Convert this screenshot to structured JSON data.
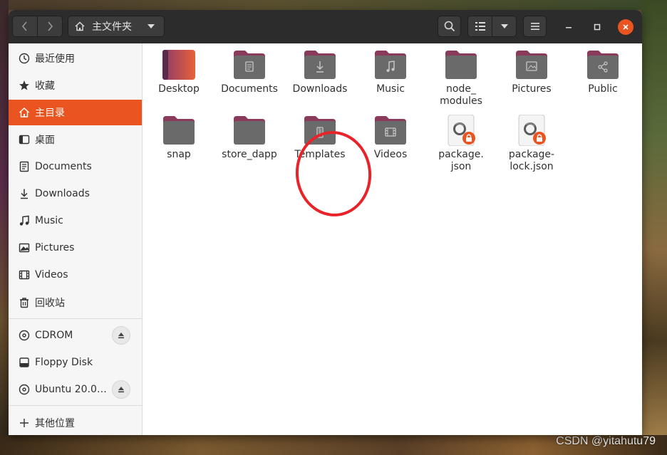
{
  "window": {
    "path_label": "主文件夹"
  },
  "sidebar": {
    "items": [
      {
        "label": "最近使用",
        "icon": "recent-icon"
      },
      {
        "label": "收藏",
        "icon": "star-icon"
      },
      {
        "label": "主目录",
        "icon": "home-icon",
        "active": true
      },
      {
        "label": "桌面",
        "icon": "desktop-icon"
      },
      {
        "label": "Documents",
        "icon": "document-icon"
      },
      {
        "label": "Downloads",
        "icon": "download-icon"
      },
      {
        "label": "Music",
        "icon": "music-icon"
      },
      {
        "label": "Pictures",
        "icon": "picture-icon"
      },
      {
        "label": "Videos",
        "icon": "video-icon"
      },
      {
        "label": "回收站",
        "icon": "trash-icon"
      }
    ],
    "devices": [
      {
        "label": "CDROM",
        "icon": "disc-icon",
        "eject": true
      },
      {
        "label": "Floppy Disk",
        "icon": "drive-icon",
        "eject": false
      },
      {
        "label": "Ubuntu 20.0…",
        "icon": "disc-icon",
        "eject": true
      }
    ],
    "other_locations": {
      "label": "其他位置",
      "icon": "plus-icon"
    }
  },
  "files": [
    {
      "name": "Desktop",
      "type": "desktop-folder"
    },
    {
      "name": "Documents",
      "type": "folder",
      "emblem": "document"
    },
    {
      "name": "Downloads",
      "type": "folder",
      "emblem": "download"
    },
    {
      "name": "Music",
      "type": "folder",
      "emblem": "music"
    },
    {
      "name": "node_\nmodules",
      "type": "folder",
      "emblem": "none"
    },
    {
      "name": "Pictures",
      "type": "folder",
      "emblem": "picture"
    },
    {
      "name": "Public",
      "type": "folder",
      "emblem": "share"
    },
    {
      "name": "snap",
      "type": "folder",
      "emblem": "none"
    },
    {
      "name": "store_dapp",
      "type": "folder",
      "emblem": "none"
    },
    {
      "name": "Templates",
      "type": "folder",
      "emblem": "template"
    },
    {
      "name": "Videos",
      "type": "folder",
      "emblem": "video"
    },
    {
      "name": "package.\njson",
      "type": "json-locked"
    },
    {
      "name": "package-\nlock.json",
      "type": "json-locked"
    }
  ],
  "colors": {
    "accent": "#e95420",
    "folder_tab": "#8a3a5a",
    "folder_body": "#6a6a6a",
    "annotation": "#e8232a"
  },
  "watermark": "CSDN @yitahutu79"
}
